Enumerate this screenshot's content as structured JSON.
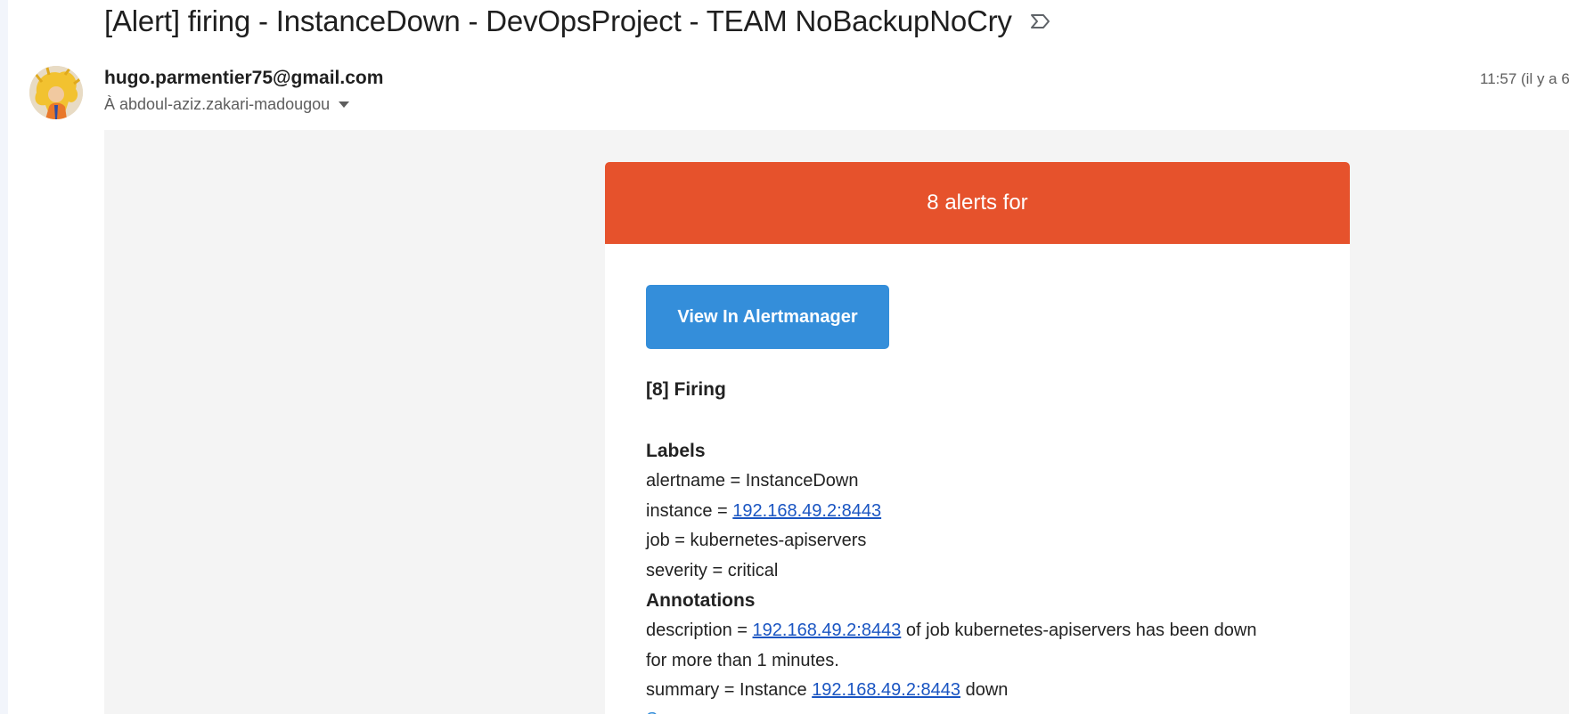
{
  "email": {
    "subject": "[Alert] firing - InstanceDown - DevOpsProject - TEAM NoBackupNoCry",
    "sender": "hugo.parmentier75@gmail.com",
    "recipient": "À abdoul-aziz.zakari-madougou",
    "time": "11:57 (il y a 6"
  },
  "alert_card": {
    "header": "8 alerts for",
    "header_color": "#e6522c",
    "button_label": "View In Alertmanager",
    "button_color": "#348eda",
    "firing_title": "[8] Firing",
    "labels_title": "Labels",
    "labels": {
      "alertname": "alertname = InstanceDown",
      "instance_prefix": "instance = ",
      "instance_link": "192.168.49.2:8443",
      "job": "job = kubernetes-apiservers",
      "severity": "severity = critical"
    },
    "annotations_title": "Annotations",
    "annotations": {
      "description_prefix": "description = ",
      "description_link": "192.168.49.2:8443",
      "description_suffix": " of job kubernetes-apiservers has been down",
      "description_line2": "for more than 1 minutes.",
      "summary_prefix": "summary = Instance ",
      "summary_link": "192.168.49.2:8443",
      "summary_suffix": " down"
    },
    "source_label": "Source"
  },
  "icons": {
    "label": "label-outline-icon",
    "avatar": "avatar-image",
    "caret": "caret-down-icon"
  }
}
